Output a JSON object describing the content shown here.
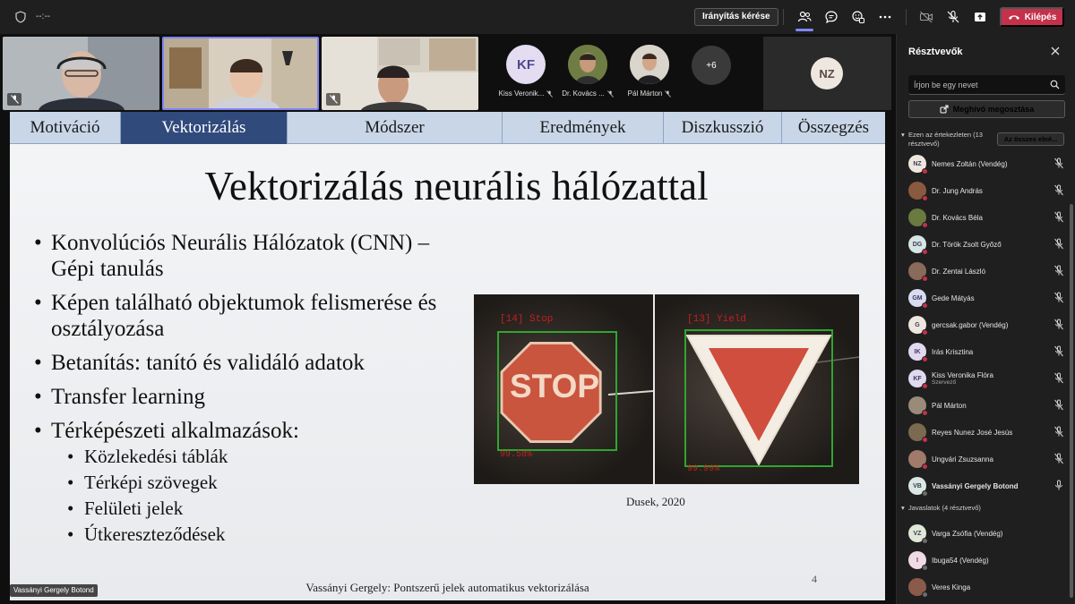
{
  "toolbar": {
    "timer": "--:--",
    "control_request": "Irányítás kérése",
    "leave": "Kilépés",
    "colors": {
      "accent": "#7f85f5",
      "leave": "#c4314b"
    }
  },
  "strip": {
    "avatars": [
      {
        "initials": "KF",
        "name": "Kiss Veronik..."
      },
      {
        "initials": "",
        "name": "Dr. Kovács ..."
      },
      {
        "initials": "",
        "name": "Pál Márton"
      }
    ],
    "more": "+6",
    "nz_initials": "NZ"
  },
  "slide": {
    "nav": [
      "Motiváció",
      "Vektorizálás",
      "Módszer",
      "Eredmények",
      "Diszkusszió",
      "Összegzés"
    ],
    "title": "Vektorizálás neurális hálózattal",
    "bullets": [
      "Konvolúciós Neurális Hálózatok (CNN) – Gépi tanulás",
      "Képen található objektumok felismerése és osztályozása",
      "Betanítás: tanító és validáló adatok",
      "Transfer learning",
      "Térképészeti alkalmazások:"
    ],
    "subbullets": [
      "Közlekedési táblák",
      "Térképi szövegek",
      "Felületi jelek",
      "Útkereszteződések"
    ],
    "image": {
      "stop_label": "[14] Stop",
      "stop_score": "99.58%",
      "yield_label": "[13] Yield",
      "yield_score": "99.99%",
      "stop_text": "STOP"
    },
    "caption": "Dusek, 2020",
    "page": "4",
    "footer": "Vassányi Gergely: Pontszerű jelek automatikus vektorizálása"
  },
  "speaker_tag": "Vassányi Gergely Botond",
  "panel": {
    "title": "Résztvevők",
    "search_placeholder": "Írjon be egy nevet",
    "share": "Meghívó megosztása",
    "in_meeting_1": "Ezen az értekezleten (13",
    "in_meeting_2": "résztvevő)",
    "mute_all": "Az összes elné...",
    "suggestions": "Javaslatok (4 résztvevő)",
    "participants": [
      {
        "initials": "NZ",
        "name": "Nemes Zoltán (Vendég)",
        "color": "#ede7df"
      },
      {
        "initials": "",
        "name": "Dr. Jung András",
        "color": "#8a5a40"
      },
      {
        "initials": "",
        "name": "Dr. Kovács Béla",
        "color": "#6a7a40"
      },
      {
        "initials": "DG",
        "name": "Dr. Török Zsolt Győző",
        "color": "#d7e6e4"
      },
      {
        "initials": "",
        "name": "Dr. Zentai László",
        "color": "#8a6a5a"
      },
      {
        "initials": "GM",
        "name": "Gede Mátyás",
        "color": "#d9dcf2"
      },
      {
        "initials": "G",
        "name": "gercsak.gabor (Vendég)",
        "color": "#ede7df"
      },
      {
        "initials": "IK",
        "name": "Irás Krisztina",
        "color": "#e0d9f0"
      },
      {
        "initials": "KF",
        "name": "Kiss Veronika Flóra",
        "sub": "Szervező",
        "color": "#e0d9f0"
      },
      {
        "initials": "",
        "name": "Pál Márton",
        "color": "#9a8a7a"
      },
      {
        "initials": "",
        "name": "Reyes Nunez José Jesús",
        "color": "#7a6a50"
      },
      {
        "initials": "",
        "name": "Ungvári Zsuzsanna",
        "color": "#a07a6a"
      },
      {
        "initials": "VB",
        "name": "Vassányi Gergely Botond",
        "color": "#d9e8e2"
      }
    ],
    "suggested": [
      {
        "initials": "VZ",
        "name": "Varga Zsófia (Vendég)",
        "color": "#dfe8d6"
      },
      {
        "initials": "I",
        "name": "Ibuga54 (Vendég)",
        "color": "#f0dbe4"
      },
      {
        "initials": "",
        "name": "Veres Kinga",
        "color": "#8a5a4a"
      }
    ]
  }
}
